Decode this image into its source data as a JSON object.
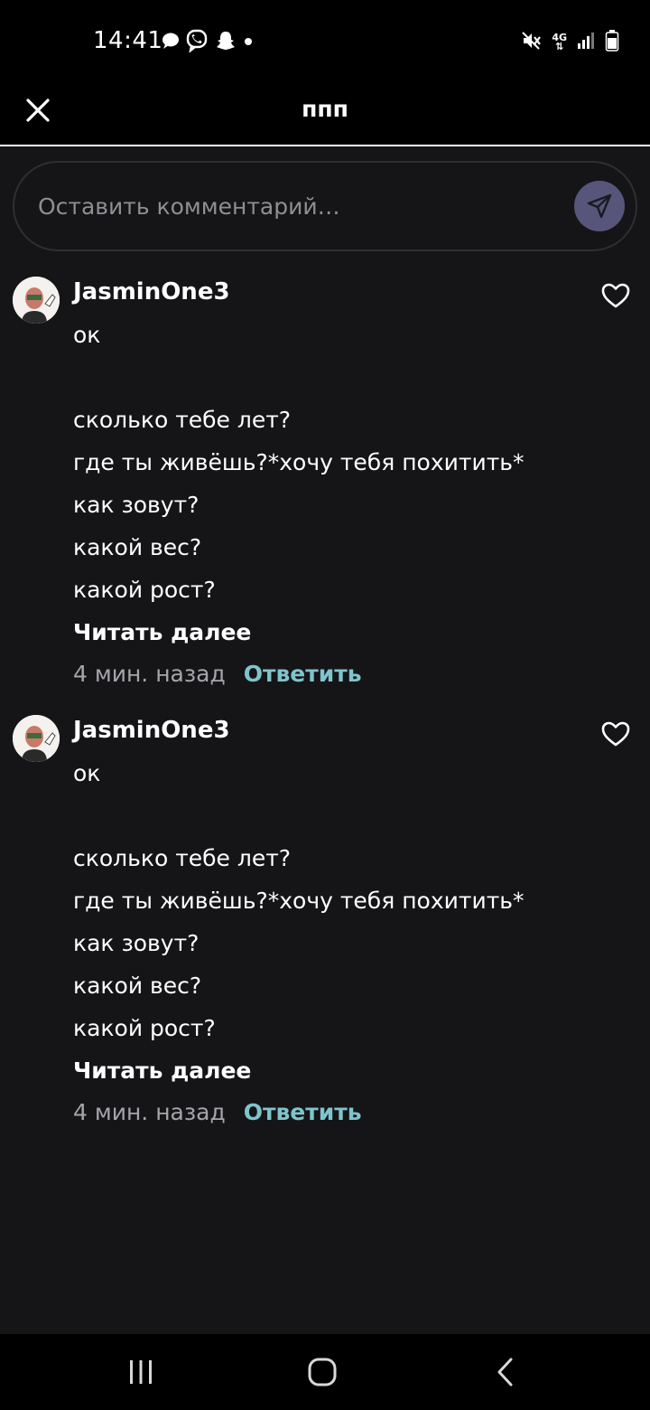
{
  "status_bar": {
    "time": "14:41",
    "network": "4G",
    "left_icons": [
      "message-icon",
      "viber-icon",
      "snapchat-icon",
      "dot-icon"
    ],
    "right_icons": [
      "mute-icon",
      "4g-icon",
      "signal-icon",
      "battery-icon"
    ]
  },
  "header": {
    "title": "ппп",
    "close_icon": "close-icon"
  },
  "comment_box": {
    "placeholder": "Оставить комментарий…",
    "send_icon": "send-icon"
  },
  "comments": [
    {
      "username": "JasminOne3",
      "lines": [
        "ок",
        "",
        "сколько тебе лет?",
        "где ты живёшь?*хочу тебя похитить*",
        "как зовут?",
        "какой вес?",
        "какой рост?"
      ],
      "read_more": "Читать далее",
      "time": "4 мин. назад",
      "reply": "Ответить"
    },
    {
      "username": "JasminOne3",
      "lines": [
        "ок",
        "",
        "сколько тебе лет?",
        "где ты живёшь?*хочу тебя похитить*",
        "как зовут?",
        "какой вес?",
        "какой рост?"
      ],
      "read_more": "Читать далее",
      "time": "4 мин. назад",
      "reply": "Ответить"
    }
  ],
  "nav_bar": {
    "icons": [
      "recents-icon",
      "home-icon",
      "back-icon"
    ]
  },
  "colors": {
    "background": "#151417",
    "reply_accent": "#7fc4cc",
    "send_button": "#57557a"
  }
}
